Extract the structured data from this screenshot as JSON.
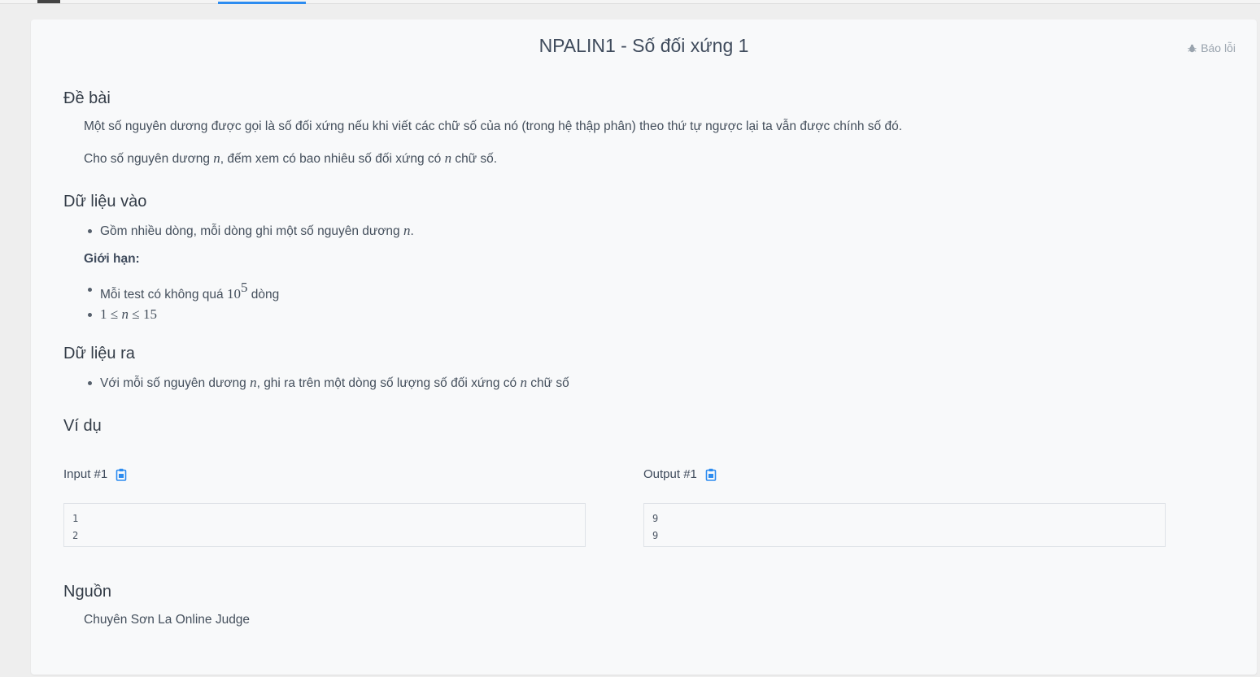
{
  "problem": {
    "title": "NPALIN1 - Số đối xứng 1",
    "report_label": "Báo lỗi"
  },
  "statement": {
    "heading": "Đề bài",
    "para1": "Một số nguyên dương được gọi là số đối xứng nếu khi viết các chữ số của nó (trong hệ thập phân) theo thứ tự ngược lại ta vẫn được chính số đó.",
    "para2_a": "Cho số nguyên dương ",
    "para2_var1": "n",
    "para2_b": ", đếm xem có bao nhiêu số đối xứng có ",
    "para2_var2": "n",
    "para2_c": " chữ số."
  },
  "input": {
    "heading": "Dữ liệu vào",
    "bullet1_a": "Gồm nhiều dòng, mỗi dòng ghi một số nguyên dương ",
    "bullet1_var": "n",
    "bullet1_b": ".",
    "limits_label": "Giới hạn:",
    "limit1_a": "Mỗi test có không quá ",
    "limit1_base": "10",
    "limit1_exp": "5",
    "limit1_b": " dòng",
    "limit2_lo": "1",
    "limit2_le1": "≤",
    "limit2_var": "n",
    "limit2_le2": "≤",
    "limit2_hi": "15"
  },
  "output": {
    "heading": "Dữ liệu ra",
    "bullet1_a": "Với mỗi số nguyên dương ",
    "bullet1_var1": "n",
    "bullet1_b": ", ghi ra trên một dòng số lượng số đối xứng có ",
    "bullet1_var2": "n",
    "bullet1_c": " chữ số"
  },
  "examples": {
    "heading": "Ví dụ",
    "input_label": "Input #1",
    "output_label": "Output #1",
    "input_text": "1\n2",
    "output_text": "9\n9"
  },
  "source": {
    "heading": "Nguồn",
    "text": "Chuyên Sơn La Online Judge"
  },
  "colors": {
    "accent": "#2d8cf0",
    "copy_icon": "#2d8cf0"
  }
}
